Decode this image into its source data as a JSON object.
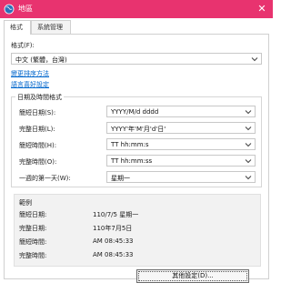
{
  "window": {
    "title": "地區",
    "close_glyph": "✕"
  },
  "tabs": [
    {
      "label": "格式",
      "active": true
    },
    {
      "label": "系統管理",
      "active": false
    }
  ],
  "format": {
    "label": "格式(F):",
    "value": "中文 (繁體，台灣)"
  },
  "links": {
    "sort_method": "變更排序方法",
    "language_prefs": "語言喜好設定"
  },
  "datetime_group": {
    "title": "日期及時間格式",
    "rows": [
      {
        "label": "簡短日期(S):",
        "value": "YYYY/M/d dddd"
      },
      {
        "label": "完整日期(L):",
        "value": "YYYY'年'M'月'd'日'"
      },
      {
        "label": "簡短時間(H):",
        "value": "TT hh:mm:s"
      },
      {
        "label": "完整時間(O):",
        "value": "TT hh:mm:ss"
      },
      {
        "label": "一週的第一天(W):",
        "value": "星期一"
      }
    ]
  },
  "examples": {
    "title": "範例",
    "rows": [
      {
        "label": "簡短日期:",
        "value": "110/7/5 星期一"
      },
      {
        "label": "完整日期:",
        "value": "110年7月5日"
      },
      {
        "label": "簡短時間:",
        "value": "AM 08:45:33"
      },
      {
        "label": "完整時間:",
        "value": "AM 08:45:33"
      }
    ]
  },
  "buttons": {
    "other_settings": "其他設定(D)..."
  },
  "colors": {
    "titlebar": "#e8336f",
    "link": "#0066cc"
  }
}
